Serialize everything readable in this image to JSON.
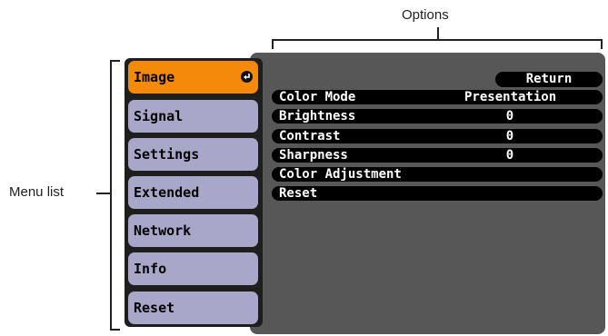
{
  "callouts": {
    "options": "Options",
    "menu_list": "Menu list"
  },
  "menu": {
    "items": [
      {
        "label": "Image",
        "active": true
      },
      {
        "label": "Signal"
      },
      {
        "label": "Settings"
      },
      {
        "label": "Extended"
      },
      {
        "label": "Network"
      },
      {
        "label": "Info"
      },
      {
        "label": "Reset"
      }
    ],
    "active_color": "#f5890a",
    "item_color": "#a8a6c9"
  },
  "options": {
    "return_label": "Return",
    "rows": [
      {
        "label": "Color Mode",
        "value": "Presentation"
      },
      {
        "label": "Brightness",
        "value": "0"
      },
      {
        "label": "Contrast",
        "value": "0"
      },
      {
        "label": "Sharpness",
        "value": "0"
      },
      {
        "label": "Color Adjustment",
        "value": ""
      },
      {
        "label": "Reset",
        "value": ""
      }
    ]
  }
}
